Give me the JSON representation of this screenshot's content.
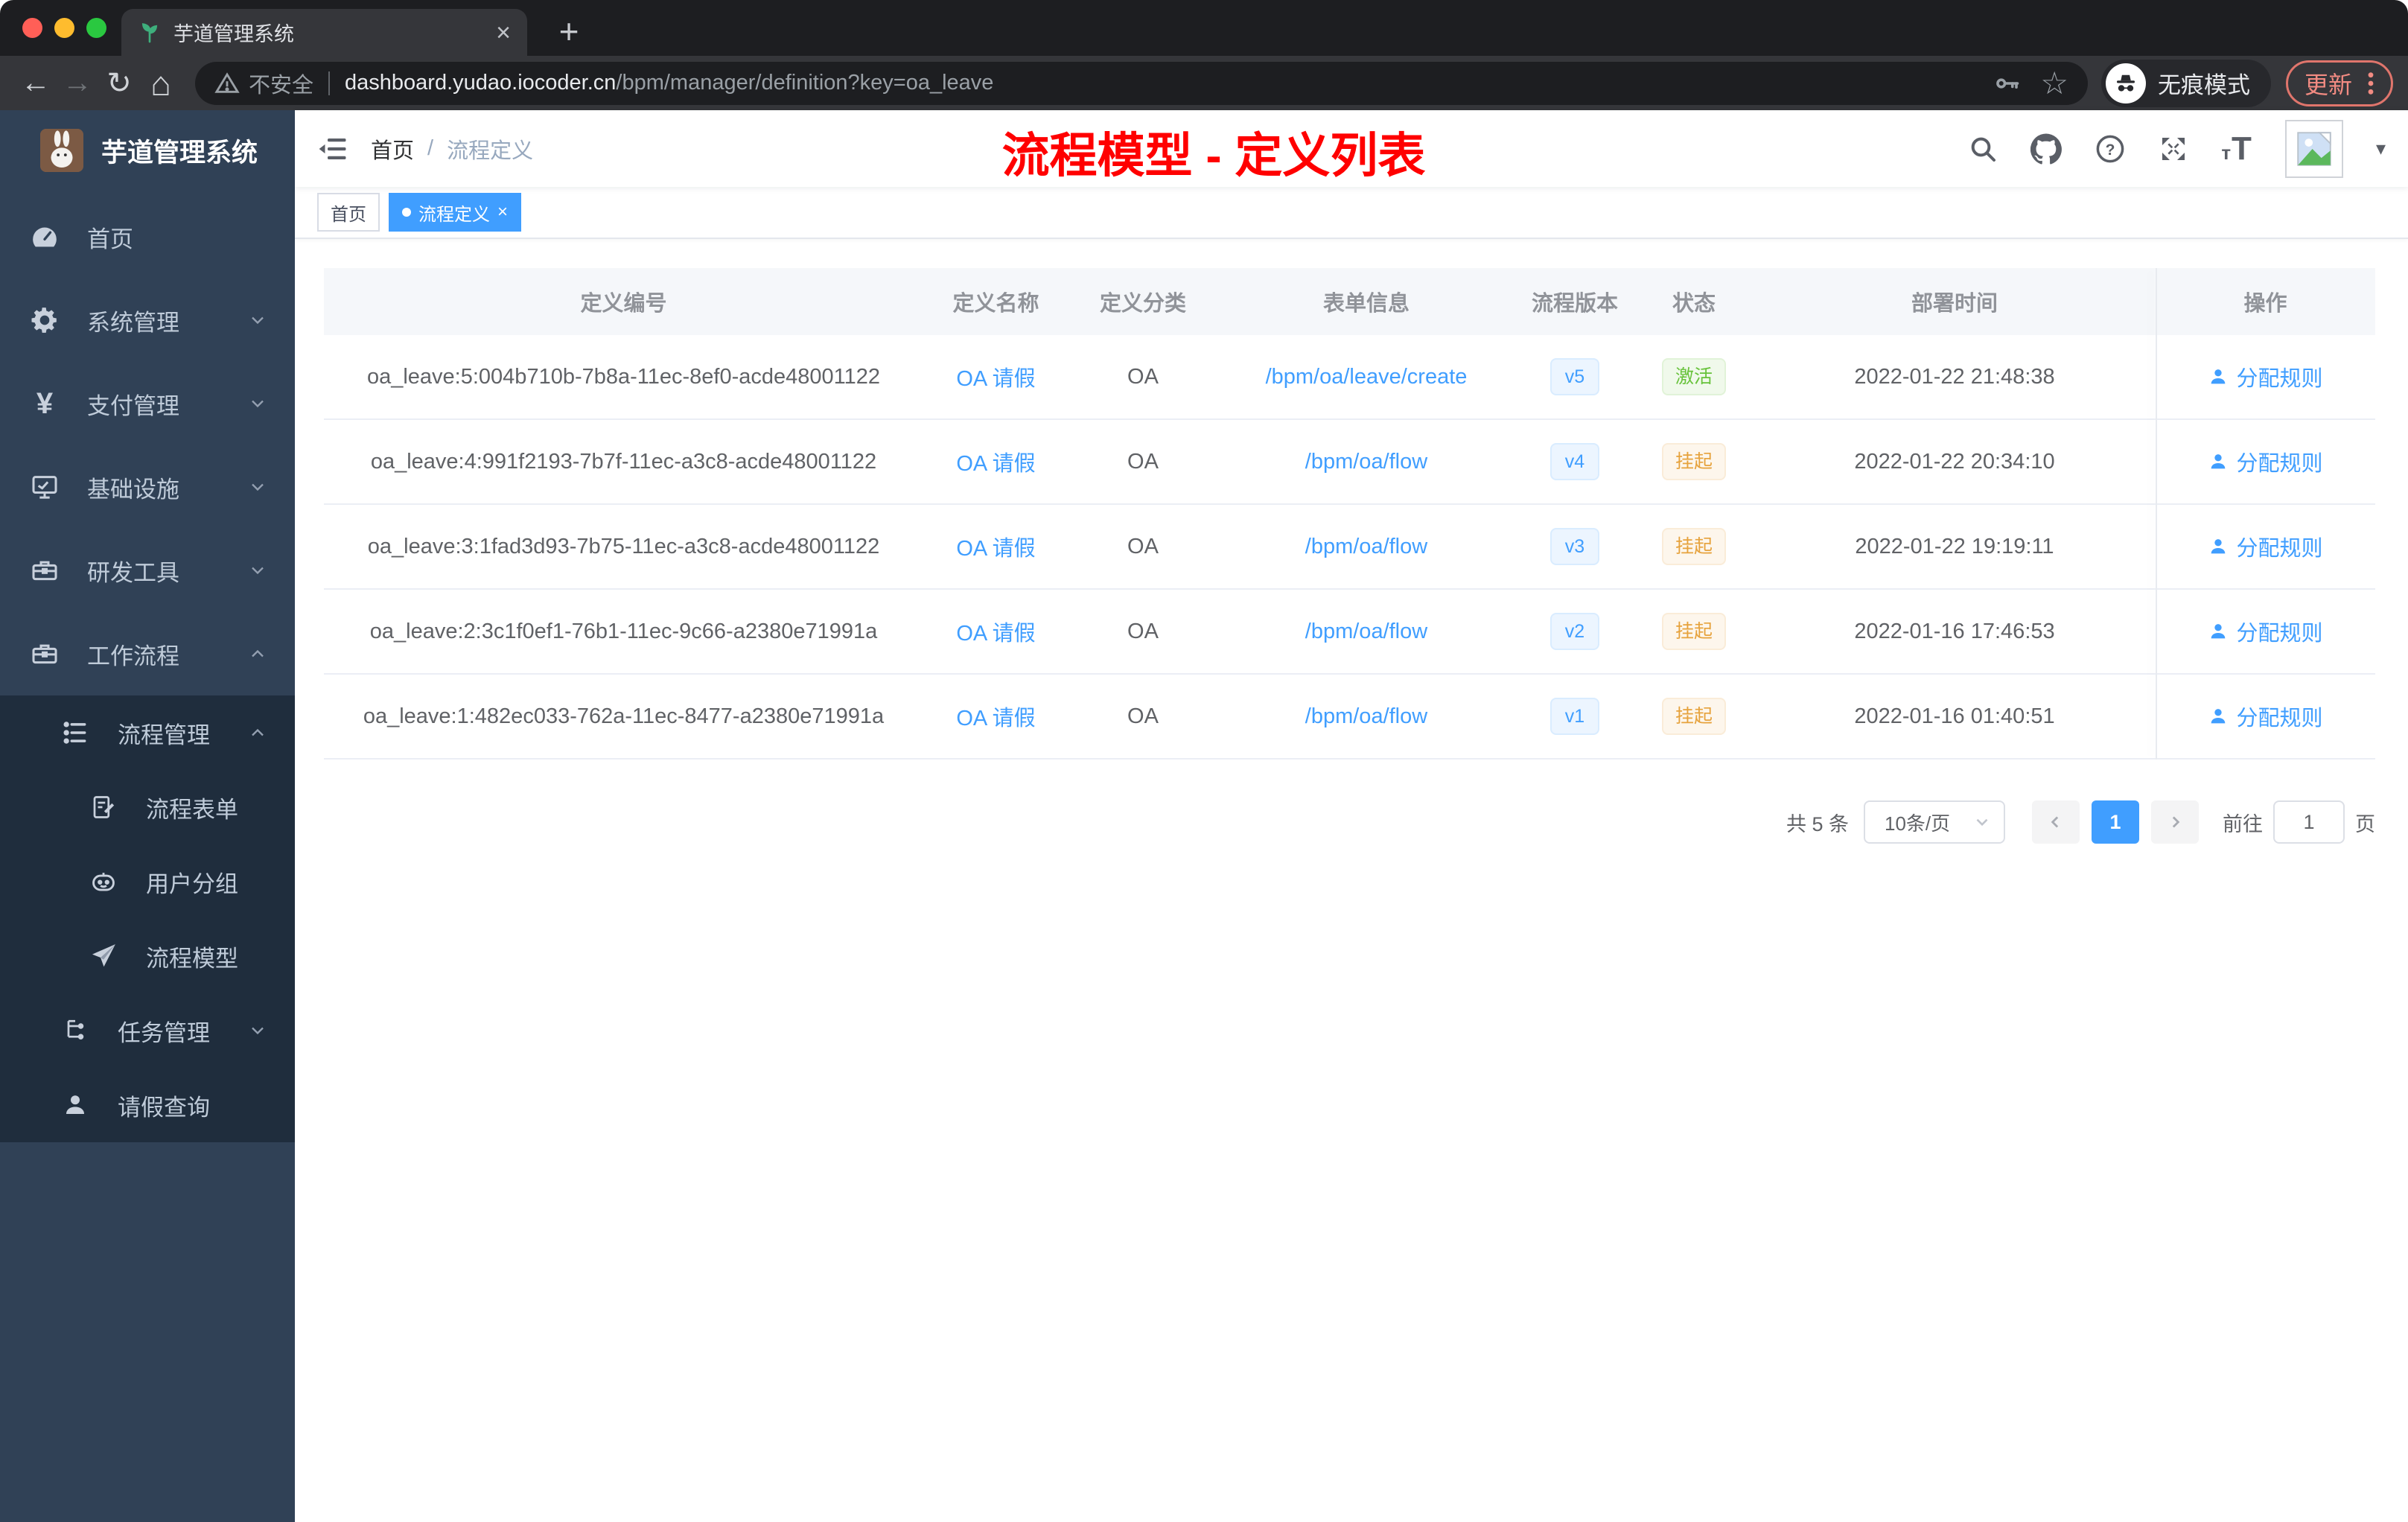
{
  "colors": {
    "accent_blue": "#409eff",
    "annotation_red": "#ff0000",
    "status_active_green": "#67c23a",
    "status_suspend_orange": "#e6a23c",
    "sidebar_bg": "#304156",
    "submenu_bg": "#1f2d3d",
    "chrome_dark": "#1d1e21",
    "chrome_toolbar": "#35363a",
    "update_salmon": "#f28b82"
  },
  "browser": {
    "tab_title": "芋道管理系统",
    "security_label": "不安全",
    "url_domain": "dashboard.yudao.iocoder.cn",
    "url_path": "/bpm/manager/definition?key=oa_leave",
    "incognito_label": "无痕模式",
    "update_label": "更新"
  },
  "sidebar": {
    "logo_title": "芋道管理系统",
    "items": [
      {
        "label": "首页"
      },
      {
        "label": "系统管理"
      },
      {
        "label": "支付管理"
      },
      {
        "label": "基础设施"
      },
      {
        "label": "研发工具"
      },
      {
        "label": "工作流程"
      }
    ],
    "submenu": [
      {
        "label": "流程管理"
      },
      {
        "label": "流程表单"
      },
      {
        "label": "用户分组"
      },
      {
        "label": "流程模型"
      },
      {
        "label": "任务管理"
      },
      {
        "label": "请假查询"
      }
    ]
  },
  "header": {
    "breadcrumb_home": "首页",
    "breadcrumb_sep": "/",
    "breadcrumb_current": "流程定义",
    "annotation": "流程模型 - 定义列表"
  },
  "tags": {
    "items": [
      {
        "label": "首页"
      },
      {
        "label": "流程定义"
      }
    ]
  },
  "table": {
    "columns": [
      "定义编号",
      "定义名称",
      "定义分类",
      "表单信息",
      "流程版本",
      "状态",
      "部署时间",
      "操作"
    ],
    "action_label": "分配规则",
    "rows": [
      {
        "id": "oa_leave:5:004b710b-7b8a-11ec-8ef0-acde48001122",
        "name": "OA 请假",
        "category": "OA",
        "form": "/bpm/oa/leave/create",
        "version": "v5",
        "status": "激活",
        "deployed_at": "2022-01-22 21:48:38"
      },
      {
        "id": "oa_leave:4:991f2193-7b7f-11ec-a3c8-acde48001122",
        "name": "OA 请假",
        "category": "OA",
        "form": "/bpm/oa/flow",
        "version": "v4",
        "status": "挂起",
        "deployed_at": "2022-01-22 20:34:10"
      },
      {
        "id": "oa_leave:3:1fad3d93-7b75-11ec-a3c8-acde48001122",
        "name": "OA 请假",
        "category": "OA",
        "form": "/bpm/oa/flow",
        "version": "v3",
        "status": "挂起",
        "deployed_at": "2022-01-22 19:19:11"
      },
      {
        "id": "oa_leave:2:3c1f0ef1-76b1-11ec-9c66-a2380e71991a",
        "name": "OA 请假",
        "category": "OA",
        "form": "/bpm/oa/flow",
        "version": "v2",
        "status": "挂起",
        "deployed_at": "2022-01-16 17:46:53"
      },
      {
        "id": "oa_leave:1:482ec033-762a-11ec-8477-a2380e71991a",
        "name": "OA 请假",
        "category": "OA",
        "form": "/bpm/oa/flow",
        "version": "v1",
        "status": "挂起",
        "deployed_at": "2022-01-16 01:40:51"
      }
    ]
  },
  "pagination": {
    "total": "共 5 条",
    "page_size": "10条/页",
    "current_page": "1",
    "goto_label": "前往",
    "goto_value": "1",
    "unit_label": "页"
  }
}
